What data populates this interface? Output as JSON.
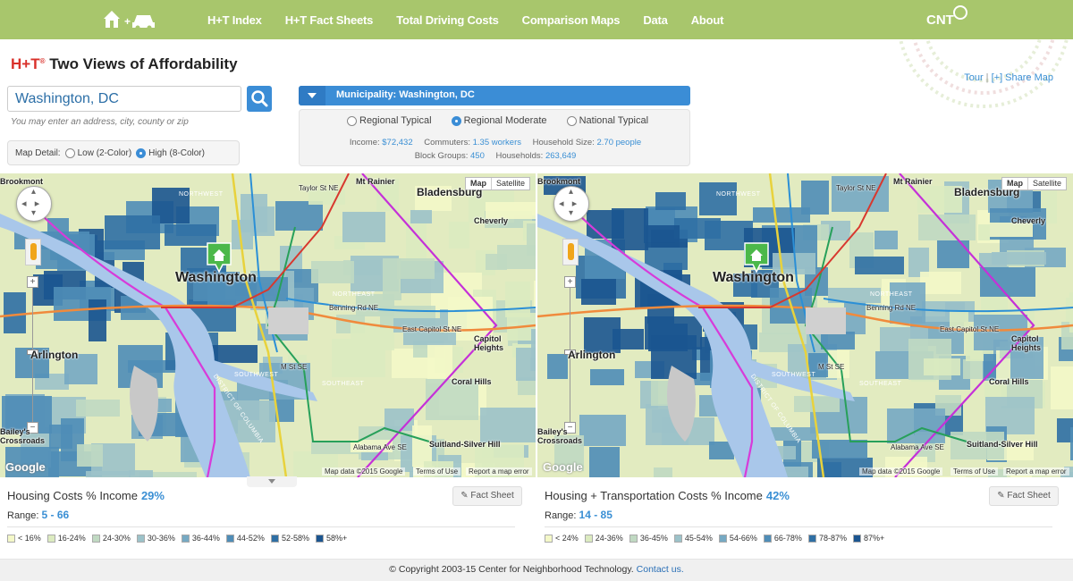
{
  "nav": {
    "logo_icon": "house-plus-car-icon",
    "items": [
      "H+T Index",
      "H+T Fact Sheets",
      "Total Driving Costs",
      "Comparison Maps",
      "Data",
      "About"
    ],
    "brand": "CNT",
    "bg_color": "#a8c66c"
  },
  "header": {
    "title_brand": "H+T",
    "title_reg": "®",
    "title_rest": " Two Views of Affordability",
    "tour_link": "Tour",
    "separator": "|",
    "share_link": "[+] Share Map"
  },
  "search": {
    "value": "Washington, DC",
    "hint": "You may enter an address, city, county or zip",
    "button_icon": "search-icon"
  },
  "map_detail": {
    "label": "Map Detail:",
    "options": [
      "Low (2-Color)",
      "High (8-Color)"
    ],
    "selected": "High (8-Color)"
  },
  "municipality": {
    "label": "Municipality: Washington, DC",
    "options": [
      "Regional Typical",
      "Regional Moderate",
      "National Typical"
    ],
    "selected": "Regional Moderate",
    "income_label": "Income:",
    "income": "$72,432",
    "commuters_label": "Commuters:",
    "commuters": "1.35 workers",
    "household_label": "Household Size:",
    "household": "2.70 people",
    "block_groups_label": "Block Groups:",
    "block_groups": "450",
    "households_label": "Households:",
    "households": "263,649"
  },
  "map": {
    "type_buttons": [
      "Map",
      "Satellite"
    ],
    "labels": {
      "washington": "Washington",
      "arlington": "Arlington",
      "bladensburg": "Bladensburg",
      "cheverly": "Cheverly",
      "mt_rainier": "Mt Rainier",
      "capitol_heights": "Capitol Heights",
      "coral_hills": "Coral Hills",
      "suitland": "Suitland-Silver Hill",
      "brookmont": "Brookmont",
      "baileys": "Bailey's Crossroads",
      "taylor": "Taylor St NE",
      "benning": "Benning Rd NE",
      "east_capitol": "East Capitol St NE",
      "mst": "M St SE",
      "alabama": "Alabama Ave SE",
      "northwest": "NORTHWEST",
      "northeast": "NORTHEAST",
      "southwest": "SOUTHWEST",
      "southeast": "SOUTHEAST",
      "dc": "DISTRICT OF COLUMBIA"
    },
    "map_data": "Map data ©2015 Google",
    "terms": "Terms of Use",
    "report": "Report a map error",
    "google": "Google"
  },
  "left_panel": {
    "heading": "Housing Costs % Income",
    "value": "29%",
    "range_label": "Range:",
    "range": "5 - 66",
    "fact_sheet": "Fact Sheet",
    "legend": [
      {
        "label": "< 16%",
        "color": "#f4f8c8"
      },
      {
        "label": "16-24%",
        "color": "#dcebc0"
      },
      {
        "label": "24-30%",
        "color": "#c0d9c2"
      },
      {
        "label": "30-36%",
        "color": "#9cc2c9"
      },
      {
        "label": "36-44%",
        "color": "#76a9c3"
      },
      {
        "label": "44-52%",
        "color": "#4f8db7"
      },
      {
        "label": "52-58%",
        "color": "#2f6fa4"
      },
      {
        "label": "58%+",
        "color": "#1b5590"
      }
    ]
  },
  "right_panel": {
    "heading": "Housing + Transportation Costs % Income",
    "value": "42%",
    "range_label": "Range:",
    "range": "14 - 85",
    "fact_sheet": "Fact Sheet",
    "legend": [
      {
        "label": "< 24%",
        "color": "#f4f8c8"
      },
      {
        "label": "24-36%",
        "color": "#dcebc0"
      },
      {
        "label": "36-45%",
        "color": "#c0d9c2"
      },
      {
        "label": "45-54%",
        "color": "#9cc2c9"
      },
      {
        "label": "54-66%",
        "color": "#76a9c3"
      },
      {
        "label": "66-78%",
        "color": "#4f8db7"
      },
      {
        "label": "78-87%",
        "color": "#2f6fa4"
      },
      {
        "label": "87%+",
        "color": "#1b5590"
      }
    ]
  },
  "footer": {
    "text": "© Copyright 2003-15 Center for Neighborhood Technology.",
    "link": "Contact us."
  }
}
